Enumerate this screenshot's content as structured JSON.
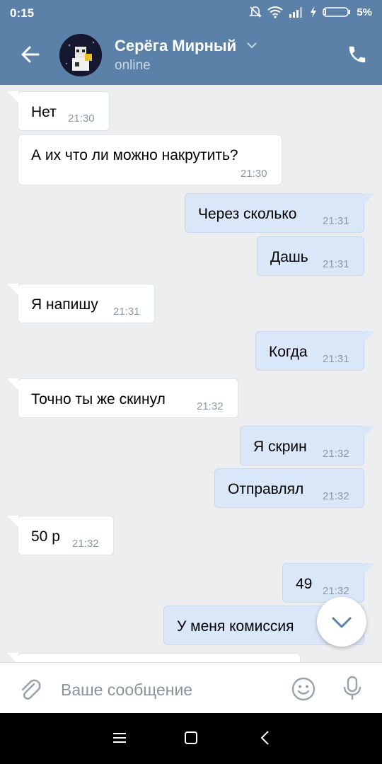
{
  "status_bar": {
    "time": "0:15",
    "battery": "5%"
  },
  "header": {
    "name": "Серёга Мирный",
    "status": "online"
  },
  "messages": [
    {
      "dir": "in",
      "text": "Нет",
      "time": "21:30"
    },
    {
      "dir": "in",
      "text": "А их что ли можно накрутить?",
      "time": "21:30"
    },
    {
      "dir": "out",
      "text": "Через сколько",
      "time": "21:31"
    },
    {
      "dir": "out",
      "text": "Дашь",
      "time": "21:31"
    },
    {
      "dir": "in",
      "text": "Я напишу",
      "time": "21:31"
    },
    {
      "dir": "out",
      "text": "Когда",
      "time": "21:31"
    },
    {
      "dir": "in",
      "text": "Точно ты же скинул",
      "time": "21:32"
    },
    {
      "dir": "out",
      "text": "Я скрин",
      "time": "21:32"
    },
    {
      "dir": "out",
      "text": "Отправлял",
      "time": "21:32"
    },
    {
      "dir": "in",
      "text": "50 р",
      "time": "21:32"
    },
    {
      "dir": "out",
      "text": "49",
      "time": "21:32"
    },
    {
      "dir": "out",
      "text": "У меня комиссия",
      "time": ""
    }
  ],
  "composer": {
    "placeholder": "Ваше сообщение"
  },
  "colors": {
    "header": "#5b81a8",
    "incoming": "#ffffff",
    "outgoing": "#dae7f8",
    "background": "#edeef0"
  },
  "icons": [
    "back-arrow-icon",
    "phone-icon",
    "chevron-down-icon",
    "paperclip-icon",
    "smile-icon",
    "mic-icon",
    "scroll-down-icon",
    "menu-icon",
    "home-icon",
    "nav-back-icon",
    "bell-muted-icon",
    "wifi-icon",
    "signal-icon",
    "charging-icon",
    "battery-icon"
  ]
}
